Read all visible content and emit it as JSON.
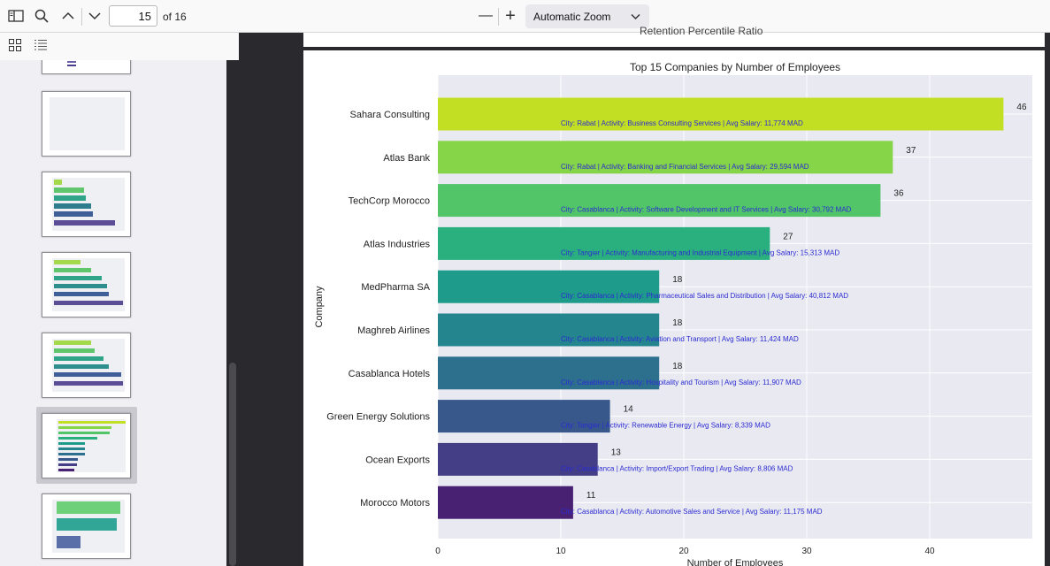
{
  "toolbar": {
    "page_number": "15",
    "page_count_label": "of 16",
    "zoom_label": "Automatic Zoom",
    "zoom_out": "—",
    "zoom_in": "+"
  },
  "prev_page_partial_title": "Retention Percentile Ratio",
  "chart_data": {
    "type": "bar",
    "orientation": "horizontal",
    "title": "Top 15 Companies by Number of Employees",
    "xlabel": "Number of Employees",
    "ylabel": "Company",
    "xlim": [
      0,
      48
    ],
    "xticks": [
      0,
      10,
      20,
      30,
      40
    ],
    "categories": [
      "Sahara Consulting",
      "Atlas Bank",
      "TechCorp Morocco",
      "Atlas Industries",
      "MedPharma SA",
      "Maghreb Airlines",
      "Casablanca Hotels",
      "Green Energy Solutions",
      "Ocean Exports",
      "Morocco Motors"
    ],
    "values": [
      46,
      37,
      36,
      27,
      18,
      18,
      18,
      14,
      13,
      11
    ],
    "value_labels": [
      "46",
      "37",
      "36",
      "27",
      "18",
      "18",
      "18",
      "14",
      "13",
      "11"
    ],
    "colors": [
      "#c2df23",
      "#86d549",
      "#52c569",
      "#2ab07f",
      "#1e9b8a",
      "#25858e",
      "#2d708e",
      "#38588c",
      "#433e85",
      "#482173"
    ],
    "annotations": [
      "City: Rabat | Activity: Business Consulting Services | Avg Salary: 11,774 MAD",
      "City: Rabat | Activity: Banking and Financial Services | Avg Salary: 29,594 MAD",
      "City: Casablanca | Activity: Software Development and IT Services | Avg Salary: 30,792 MAD",
      "City: Tangier | Activity: Manufacturing and Industrial Equipment | Avg Salary: 15,313 MAD",
      "City: Casablanca | Activity: Pharmaceutical Sales and Distribution | Avg Salary: 40,812 MAD",
      "City: Casablanca | Activity: Aviation and Transport | Avg Salary: 11,424 MAD",
      "City: Casablanca | Activity: Hospitality and Tourism | Avg Salary: 11,907 MAD",
      "City: Tangier | Activity: Renewable Energy | Avg Salary: 8,339 MAD",
      "City: Casablanca | Activity: Import/Export Trading | Avg Salary: 8,806 MAD",
      "City: Casablanca | Activity: Automotive Sales and Service | Avg Salary: 11,175 MAD"
    ],
    "plot_bg": "#e9e9f2",
    "grid": true
  }
}
